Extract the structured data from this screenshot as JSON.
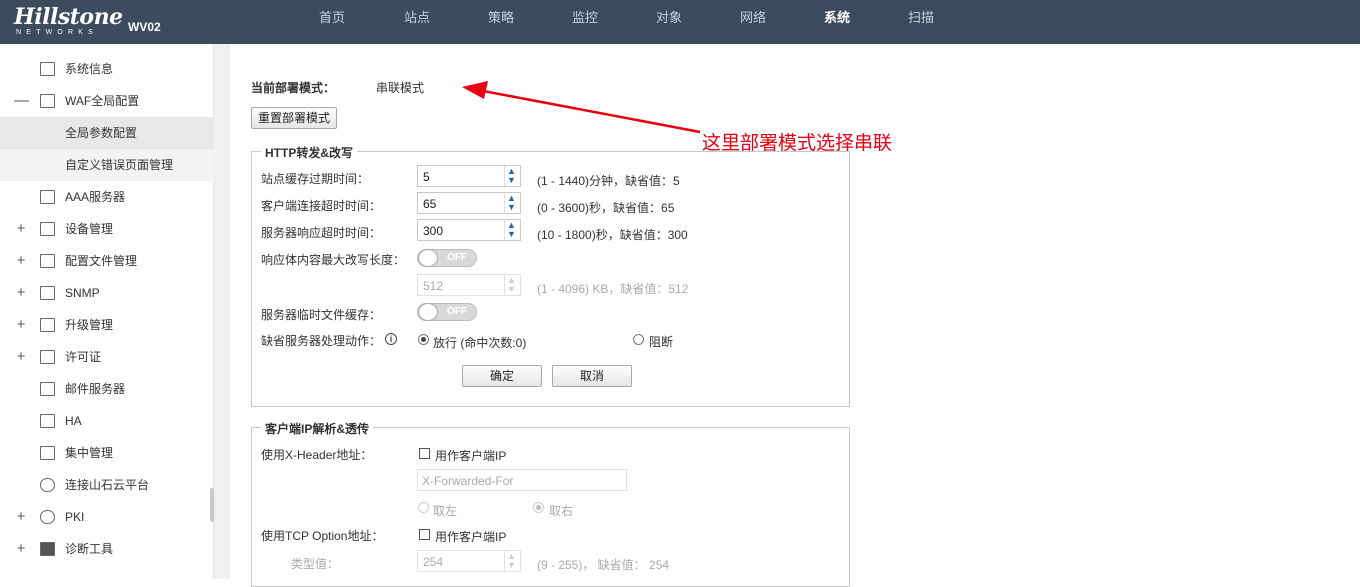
{
  "header": {
    "logo_main": "Hillstone",
    "logo_sub": "NETWORKS",
    "model": "WV02",
    "nav": [
      "首页",
      "站点",
      "策略",
      "监控",
      "对象",
      "网络",
      "系统",
      "扫描"
    ],
    "active_nav": "系统"
  },
  "sidebar": {
    "items": [
      {
        "label": "系统信息",
        "toggle": ""
      },
      {
        "label": "WAF全局配置",
        "toggle": "—"
      },
      {
        "label": "全局参数配置",
        "toggle": ""
      },
      {
        "label": "自定义错误页面管理",
        "toggle": ""
      },
      {
        "label": "AAA服务器",
        "toggle": ""
      },
      {
        "label": "设备管理",
        "toggle": "+"
      },
      {
        "label": "配置文件管理",
        "toggle": "+"
      },
      {
        "label": "SNMP",
        "toggle": "+"
      },
      {
        "label": "升级管理",
        "toggle": "+"
      },
      {
        "label": "许可证",
        "toggle": "+"
      },
      {
        "label": "邮件服务器",
        "toggle": ""
      },
      {
        "label": "HA",
        "toggle": ""
      },
      {
        "label": "集中管理",
        "toggle": ""
      },
      {
        "label": "连接山石云平台",
        "toggle": ""
      },
      {
        "label": "PKI",
        "toggle": "+"
      },
      {
        "label": "诊断工具",
        "toggle": "+"
      }
    ]
  },
  "deploy": {
    "label": "当前部署模式：",
    "value": "串联模式",
    "reset_button": "重置部署模式"
  },
  "annotation": "这里部署模式选择串联",
  "http": {
    "legend": "HTTP转发&改写",
    "site_cache_label": "站点缓存过期时间：",
    "site_cache_value": "5",
    "site_cache_hint": "(1 - 1440)分钟，缺省值：5",
    "client_timeout_label": "客户端连接超时时间：",
    "client_timeout_value": "65",
    "client_timeout_hint": "(0 - 3600)秒，缺省值：65",
    "server_timeout_label": "服务器响应超时时间：",
    "server_timeout_value": "300",
    "server_timeout_hint": "(10 - 1800)秒，缺省值：300",
    "rewrite_len_label": "响应体内容最大改写长度：",
    "rewrite_switch": "OFF",
    "rewrite_len_value": "512",
    "rewrite_len_hint": "(1 - 4096) KB，缺省值：512",
    "temp_cache_label": "服务器临时文件缓存：",
    "temp_cache_switch": "OFF",
    "default_action_label": "缺省服务器处理动作：",
    "action_pass": "放行 (命中次数:0)",
    "action_block": "阻断",
    "ok_button": "确定",
    "cancel_button": "取消"
  },
  "client_ip": {
    "legend": "客户端IP解析&透传",
    "xheader_label": "使用X-Header地址：",
    "xheader_check": "用作客户端IP",
    "xheader_value": "X-Forwarded-For",
    "take_left": "取左",
    "take_right": "取右",
    "tcp_label": "使用TCP Option地址：",
    "tcp_check": "用作客户端IP",
    "type_label": "类型值：",
    "type_value": "254",
    "type_hint": "(9 - 255)，  缺省值：  254"
  },
  "colors": {
    "topbar": "#3c4b5e",
    "annotation": "#e60012",
    "spinner_arrow": "#2a62a8"
  }
}
